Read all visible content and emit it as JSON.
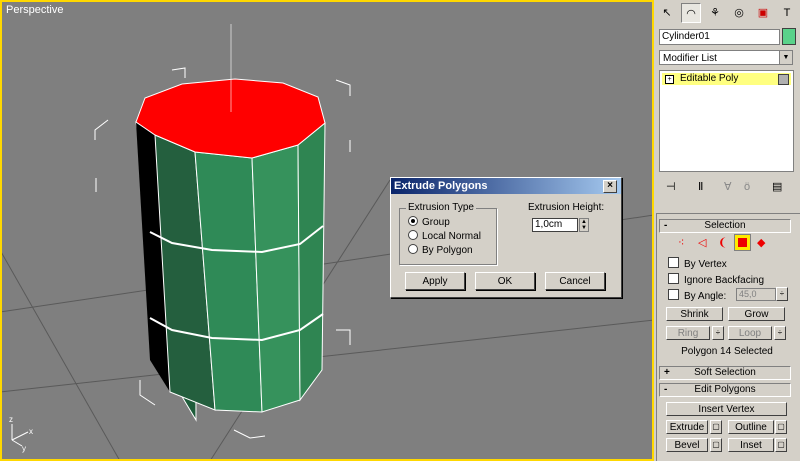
{
  "viewport": {
    "label": "Perspective"
  },
  "dialog": {
    "title": "Extrude Polygons",
    "close_glyph": "×",
    "group_label": "Extrusion Type",
    "options": [
      "Group",
      "Local Normal",
      "By Polygon"
    ],
    "selected_option": "Group",
    "height_label": "Extrusion Height:",
    "height_value": "1,0cm",
    "buttons": {
      "apply": "Apply",
      "ok": "OK",
      "cancel": "Cancel"
    }
  },
  "panel": {
    "toolbar_icons": [
      "create-icon",
      "modify-icon",
      "hierarchy-icon",
      "motion-icon",
      "display-icon",
      "utilities-icon"
    ],
    "object_name": "Cylinder01",
    "object_color": "#5ad28a",
    "modifier_list": "Modifier List",
    "stack_item": "Editable Poly",
    "stack_tools": [
      "pin-stack-icon",
      "show-end-result-icon",
      "make-unique-icon",
      "remove-modifier-icon",
      "configure-icon"
    ],
    "selection": {
      "title": "Selection",
      "sign": "-",
      "subobject_icons": [
        "vertex-icon",
        "edge-icon",
        "border-icon",
        "polygon-icon",
        "element-icon"
      ],
      "by_vertex": "By Vertex",
      "ignore_backfacing": "Ignore Backfacing",
      "by_angle": "By Angle:",
      "angle_value": "45,0",
      "shrink": "Shrink",
      "grow": "Grow",
      "ring": "Ring",
      "loop": "Loop",
      "status": "Polygon 14 Selected"
    },
    "soft_selection": {
      "title": "Soft Selection",
      "sign": "+"
    },
    "edit_polygons": {
      "title": "Edit Polygons",
      "sign": "-",
      "insert_vertex": "Insert Vertex",
      "extrude": "Extrude",
      "outline": "Outline",
      "bevel": "Bevel",
      "inset": "Inset"
    }
  },
  "colors": {
    "viewport_bg": "#7f7f7f",
    "viewport_border": "#ffd800",
    "cylinder_side": "#2e7d4f",
    "cylinder_top": "#ff0000",
    "title_bar": "#0a246a",
    "stack_highlight": "#ffff80"
  }
}
